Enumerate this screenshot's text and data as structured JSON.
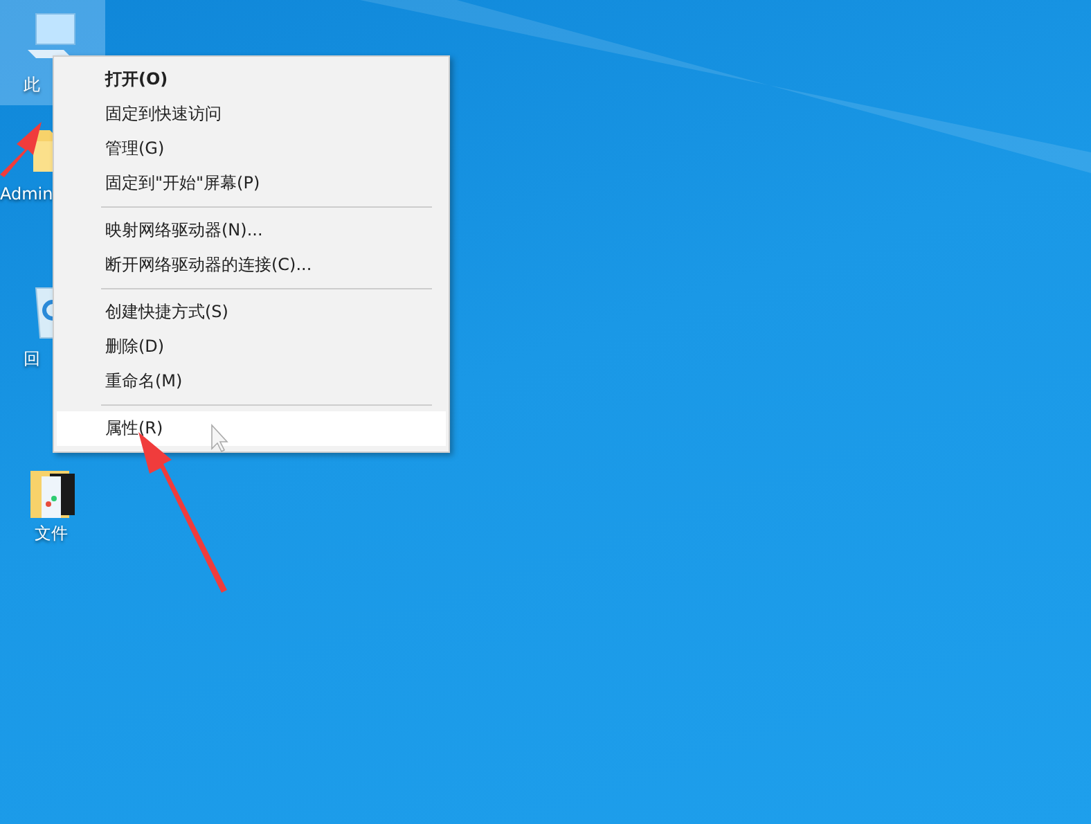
{
  "desktop_icons": [
    {
      "kind": "computer",
      "label": "此",
      "selected": true
    },
    {
      "kind": "folder",
      "label": "Admin",
      "selected": false
    },
    {
      "kind": "recycle",
      "label": "回",
      "selected": false
    },
    {
      "kind": "files",
      "label": "文件",
      "selected": false
    }
  ],
  "context_menu": {
    "items": [
      {
        "kind": "item",
        "label": "打开(O)",
        "bold": true,
        "selected": false
      },
      {
        "kind": "item",
        "label": "固定到快速访问",
        "bold": false,
        "selected": false
      },
      {
        "kind": "item",
        "label": "管理(G)",
        "bold": false,
        "selected": false
      },
      {
        "kind": "item",
        "label": "固定到\"开始\"屏幕(P)",
        "bold": false,
        "selected": false
      },
      {
        "kind": "separator"
      },
      {
        "kind": "item",
        "label": "映射网络驱动器(N)...",
        "bold": false,
        "selected": false
      },
      {
        "kind": "item",
        "label": "断开网络驱动器的连接(C)...",
        "bold": false,
        "selected": false
      },
      {
        "kind": "separator"
      },
      {
        "kind": "item",
        "label": "创建快捷方式(S)",
        "bold": false,
        "selected": false
      },
      {
        "kind": "item",
        "label": "删除(D)",
        "bold": false,
        "selected": false
      },
      {
        "kind": "item",
        "label": "重命名(M)",
        "bold": false,
        "selected": false
      },
      {
        "kind": "separator"
      },
      {
        "kind": "item",
        "label": "属性(R)",
        "bold": false,
        "selected": true
      }
    ]
  }
}
